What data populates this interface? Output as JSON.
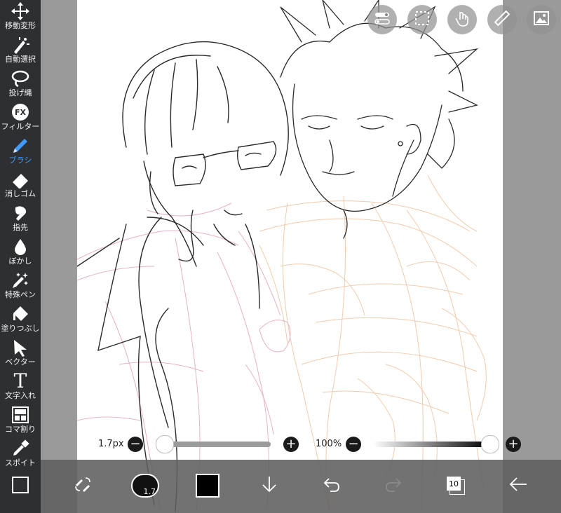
{
  "tools": [
    {
      "label": "移動変形",
      "icon": "move-icon"
    },
    {
      "label": "自動選択",
      "icon": "magic-wand-icon"
    },
    {
      "label": "投げ縄",
      "icon": "lasso-icon"
    },
    {
      "label": "フィルター",
      "icon": "fx-icon",
      "icon_text": "FX"
    },
    {
      "label": "ブラシ",
      "icon": "brush-icon",
      "active": true
    },
    {
      "label": "消しゴム",
      "icon": "eraser-icon"
    },
    {
      "label": "指先",
      "icon": "finger-icon"
    },
    {
      "label": "ぼかし",
      "icon": "blur-drop-icon"
    },
    {
      "label": "特殊ペン",
      "icon": "special-pen-icon"
    },
    {
      "label": "塗りつぶし",
      "icon": "bucket-icon"
    },
    {
      "label": "ベクター",
      "icon": "vector-arrow-icon"
    },
    {
      "label": "文字入れ",
      "icon": "text-icon",
      "icon_text": "T"
    },
    {
      "label": "コマ割り",
      "icon": "panel-icon"
    },
    {
      "label": "スポイト",
      "icon": "eyedropper-icon"
    },
    {
      "label": "",
      "icon": "canvas-frame-icon"
    }
  ],
  "top_buttons": [
    "toggle-icon",
    "selection-icon",
    "hand-touch-icon",
    "ruler-icon",
    "image-icon"
  ],
  "brush_size": {
    "label": "1.7px",
    "value": 0.0
  },
  "opacity": {
    "label": "100%",
    "value": 1.0
  },
  "bottom": {
    "brush_badge": "1.7",
    "layer_count": "10"
  },
  "colors": {
    "active_tool": "#3f9bff",
    "current_color": "#000000"
  }
}
